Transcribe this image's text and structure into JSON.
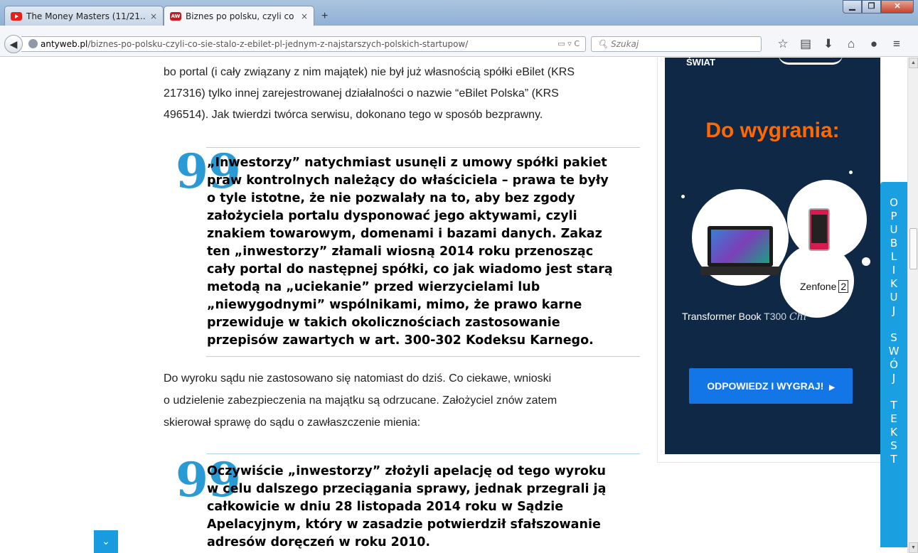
{
  "browser": {
    "tabs": [
      {
        "label": "The Money Masters (11/21...",
        "close": "×"
      },
      {
        "label": "Biznes po polsku, czyli co s...",
        "close": "×"
      }
    ],
    "new_tab": "+",
    "window_buttons": {
      "minimize": "▁",
      "maximize": "❐",
      "close": "✕"
    },
    "url_host": "antyweb.pl",
    "url_path": "/biznes-po-polsku-czyli-co-sie-stalo-z-ebilet-pl-jednym-z-najstarszych-polskich-startupow/",
    "url_icons": "▭ ▿ C",
    "search_placeholder": "Szukaj",
    "toolbar_icons": [
      "star-icon",
      "reading-list-icon",
      "download-icon",
      "home-icon",
      "chat-icon",
      "menu-icon"
    ],
    "toolbar_glyphs": {
      "star": "☆",
      "library": "▤",
      "download": "⬇",
      "home": "⌂",
      "chat": "●",
      "menu": "≡"
    },
    "back_glyph": "◀"
  },
  "article": {
    "para1": [
      "bo portal (i cały związany z nim majątek) nie był już własnością spółki eBilet (KRS",
      "217316) tylko innej zarejestrowanej działalności o nazwie “eBilet Polska” (KRS",
      "496514). Jak twierdzi twórca serwisu, dokonano tego w sposób bezprawny."
    ],
    "quote1": [
      "„Inwestorzy” natychmiast usunęli z umowy spółki pakiet",
      "praw kontrolnych należący do właściciela – prawa te były",
      "o tyle istotne, że nie pozwalały na to, aby bez zgody",
      "założyciela portalu dysponować jego aktywami, czyli",
      "znakiem towarowym, domenami i bazami danych. Zakaz",
      "ten „inwestorzy” złamali wiosną 2014 roku przenosząc",
      "cały portal do następnej spółki, co jak wiadomo jest starą",
      "metodą na „uciekanie” przed wierzycielami lub",
      "„niewygodnymi” wspólnikami, mimo, że prawo karne",
      "przewiduje w takich okolicznościach zastosowanie",
      "przepisów zawartych w art. 300-302 Kodeksu Karnego."
    ],
    "para2": [
      "Do wyroku sądu nie zastosowano się natomiast do dziś. Co ciekawe, wnioski",
      "o udzielenie zabezpieczenia na majątku są odrzucane. Założyciel znów zatem",
      "skierował sprawę do sądu o zawłaszczenie mienia:"
    ],
    "quote2": [
      "Oczywiście „inwestorzy” złożyli apelację od tego wyroku",
      "w celu dalszego przeciągania sprawy, jednak przegrali ją",
      "całkowicie w dniu 28 listopada 2014 roku w Sądzie",
      "Apelacyjnym, który w zasadzie potwierdził sfałszowanie",
      "adresów doręczeń w roku 2010."
    ],
    "quote_mark": "99"
  },
  "ad": {
    "top_text": "ŚWIAT",
    "title": "Do wygrania:",
    "zenfone_label": "Zenfone",
    "zenfone_number": "2",
    "transformer_label": "Transformer Book",
    "transformer_model": "T300",
    "transformer_suffix": "Chi",
    "button_label": "ODPOWIEDZ I WYGRAJ!",
    "button_arrow": "▶"
  },
  "side_button": {
    "text": "O\nP\nU\nB\nL\nI\nK\nU\nJ\n\nS\nW\nÓ\nJ\n\nT\nE\nK\nS\nT"
  },
  "scroll_down_glyph": "⌄",
  "scrollbar_glyphs": {
    "up": "▲",
    "down": "▼"
  }
}
